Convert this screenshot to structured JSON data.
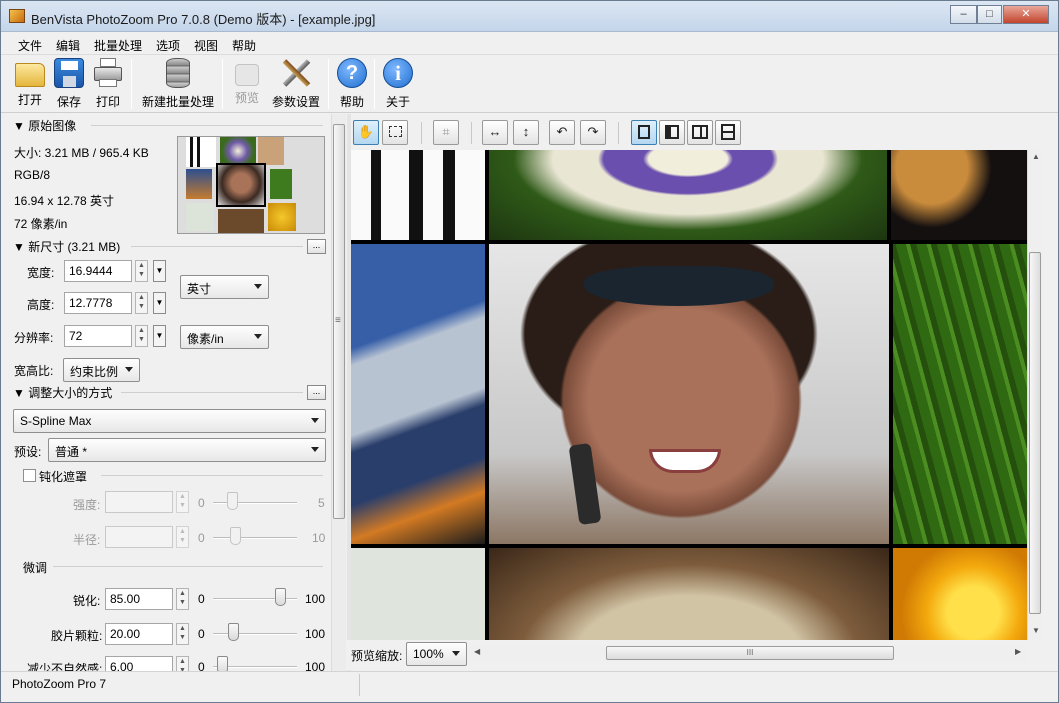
{
  "window": {
    "title": "BenVista PhotoZoom Pro 7.0.8 (Demo 版本) - [example.jpg]",
    "minimize": "–",
    "maximize": "□",
    "close": "✕"
  },
  "menu": [
    "文件",
    "编辑",
    "批量处理",
    "选项",
    "视图",
    "帮助"
  ],
  "toolbar": {
    "open": {
      "label": "打开",
      "icon": "folder-icon"
    },
    "save": {
      "label": "保存",
      "icon": "floppy-disk-icon"
    },
    "print": {
      "label": "打印",
      "icon": "printer-icon"
    },
    "new_batch": {
      "label": "新建批量处理",
      "icon": "database-stack-icon"
    },
    "preview": {
      "label": "预览",
      "icon": "preview-icon"
    },
    "settings": {
      "label": "参数设置",
      "icon": "tools-icon"
    },
    "help": {
      "label": "帮助",
      "icon": "help-icon"
    },
    "about": {
      "label": "关于",
      "icon": "info-icon"
    }
  },
  "original": {
    "header": "▼ 原始图像",
    "size": "大小: 3.21 MB / 965.4 KB",
    "mode": "RGB/8",
    "dims": "16.94 x 12.78 英寸",
    "dpi": "72 像素/in"
  },
  "new_size": {
    "header": "▼ 新尺寸 (3.21 MB)",
    "more": "...",
    "width_label": "宽度:",
    "width": "16.9444",
    "height_label": "高度:",
    "height": "12.7778",
    "res_label": "分辨率:",
    "res": "72",
    "unit_size": "英寸",
    "unit_res": "像素/in",
    "aspect_label": "宽高比:",
    "aspect": "约束比例"
  },
  "method": {
    "header": "▼ 调整大小的方式",
    "more": "...",
    "algorithm": "S-Spline Max",
    "preset_label": "预设:",
    "preset": "普通 *"
  },
  "unsharp": {
    "label": "钝化遮罩",
    "strength_label": "强度:",
    "radius_label": "半径:",
    "min": "0",
    "strength_max": "5",
    "radius_max": "10"
  },
  "fine": {
    "label": "微调",
    "rows": [
      {
        "label": "锐化:",
        "value": "85.00",
        "min": "0",
        "max": "100",
        "level": 0.85
      },
      {
        "label": "胶片颗粒:",
        "value": "20.00",
        "min": "0",
        "max": "100",
        "level": 0.2
      },
      {
        "label": "减少不自然感:",
        "value": "6.00",
        "min": "0",
        "max": "100",
        "level": 0.06
      }
    ]
  },
  "view": {
    "zoom_label": "预览缩放:",
    "zoom": "100%",
    "hscroll_grip": "III",
    "vscroll_grip": "≡"
  },
  "status": "PhotoZoom Pro 7",
  "colors": {
    "accent": "#3c7fb1",
    "help_blue": "#1f6fd0",
    "titlebar": "#c4d5ea"
  }
}
